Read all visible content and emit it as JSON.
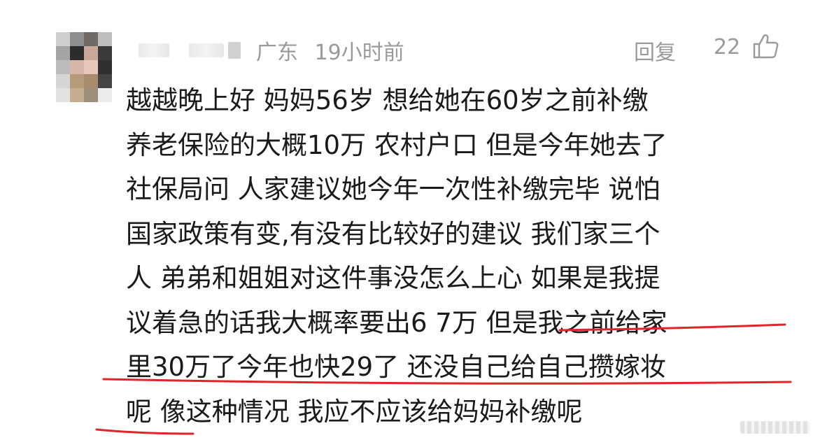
{
  "comment": {
    "location": "广东",
    "time": "19小时前",
    "reply_label": "回复",
    "like_count": "22",
    "lines": [
      "越越晚上好 妈妈56岁 想给她在60岁之前补缴",
      "养老保险的大概10万 农村户口 但是今年她去了",
      "社保局问 人家建议她今年一次性补缴完毕 说怕",
      "国家政策有变,有没有比较好的建议 我们家三个",
      "人 弟弟和姐姐对这件事没怎么上心 如果是我提",
      "议着急的话我大概率要出6 7万 但是我之前给家",
      "里30万了今年也快29了 还没自己给自己攒嫁妆",
      "呢 像这种情况 我应不应该给妈妈补缴呢"
    ],
    "icons": {
      "like": "thumbs-up-icon",
      "avatar": "avatar-image"
    },
    "colors": {
      "meta": "#9a9a9a",
      "text": "#1a1a1a",
      "underline": "#e0242b"
    }
  }
}
